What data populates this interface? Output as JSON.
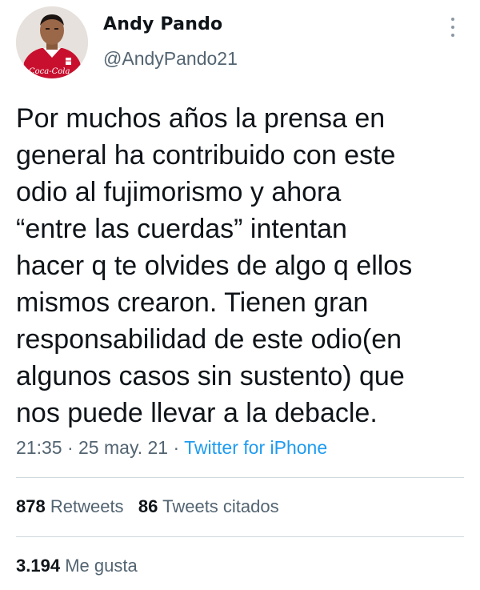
{
  "author": {
    "name": "Andy Pando",
    "handle": "@AndyPando21",
    "avatar_logo_text": "Coca-Cola"
  },
  "tweet": {
    "lines": [
      "Por muchos años la prensa en",
      "general ha contribuido con este",
      "odio al fujimorismo y ahora",
      "“entre las cuerdas” intentan",
      "hacer q te olvides de algo q ellos",
      "mismos crearon. Tienen gran",
      "responsabilidad de este odio(en",
      "algunos casos sin sustento) que",
      "nos puede llevar a la debacle."
    ],
    "time": "21:35",
    "separator": "·",
    "date": "25 may. 21",
    "source": "Twitter for iPhone"
  },
  "stats": {
    "retweets_count": "878",
    "retweets_label": "Retweets",
    "quotes_count": "86",
    "quotes_label": "Tweets citados",
    "likes_count": "3.194",
    "likes_label": "Me gusta"
  },
  "colors": {
    "text": "#0f1419",
    "secondary": "#536471",
    "link": "#1d9bf0",
    "divider": "#cfd9de"
  },
  "icons": {
    "more": "more-vertical-icon"
  }
}
